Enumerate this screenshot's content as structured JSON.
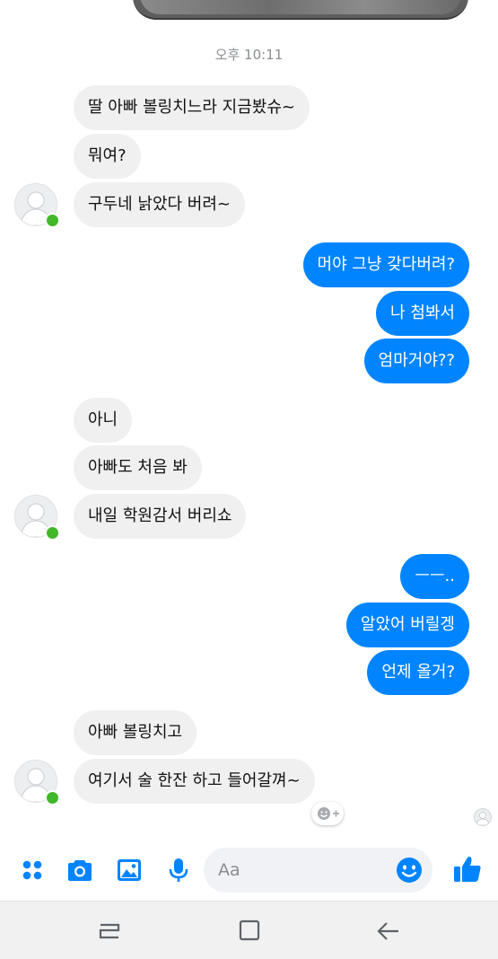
{
  "chat": {
    "timestamp": "오후 10:11",
    "messages": [
      {
        "from": "other",
        "text": "딸 아빠 볼링치느라 지금봤슈~"
      },
      {
        "from": "other",
        "text": "뭐여?"
      },
      {
        "from": "other",
        "text": "구두네 낡았다 버려~"
      },
      {
        "from": "me",
        "text": "머야 그냥 갖다버려?"
      },
      {
        "from": "me",
        "text": "나 첨봐서"
      },
      {
        "from": "me",
        "text": "엄마거야??"
      },
      {
        "from": "other",
        "text": "아니"
      },
      {
        "from": "other",
        "text": "아빠도 처음 봐"
      },
      {
        "from": "other",
        "text": "내일 학원감서 버리쇼"
      },
      {
        "from": "me",
        "text": "ㅡㅡ.."
      },
      {
        "from": "me",
        "text": "알았어 버릴겡"
      },
      {
        "from": "me",
        "text": "언제 올거?"
      },
      {
        "from": "other",
        "text": "아빠 볼링치고"
      },
      {
        "from": "other",
        "text": "여기서 술 한잔 하고 들어갈껴~"
      }
    ]
  },
  "composer": {
    "placeholder": "Aa",
    "icons": [
      "apps-icon",
      "camera-icon",
      "gallery-icon",
      "microphone-icon",
      "emoji-icon",
      "thumbs-up-icon"
    ]
  },
  "colors": {
    "outgoing_bubble": "#0084ff",
    "incoming_bubble": "#f0f0f0",
    "online_dot": "#42b72a",
    "accent": "#0084ff"
  },
  "navbar": {
    "icons": [
      "recent-apps-icon",
      "home-icon",
      "back-icon"
    ]
  }
}
